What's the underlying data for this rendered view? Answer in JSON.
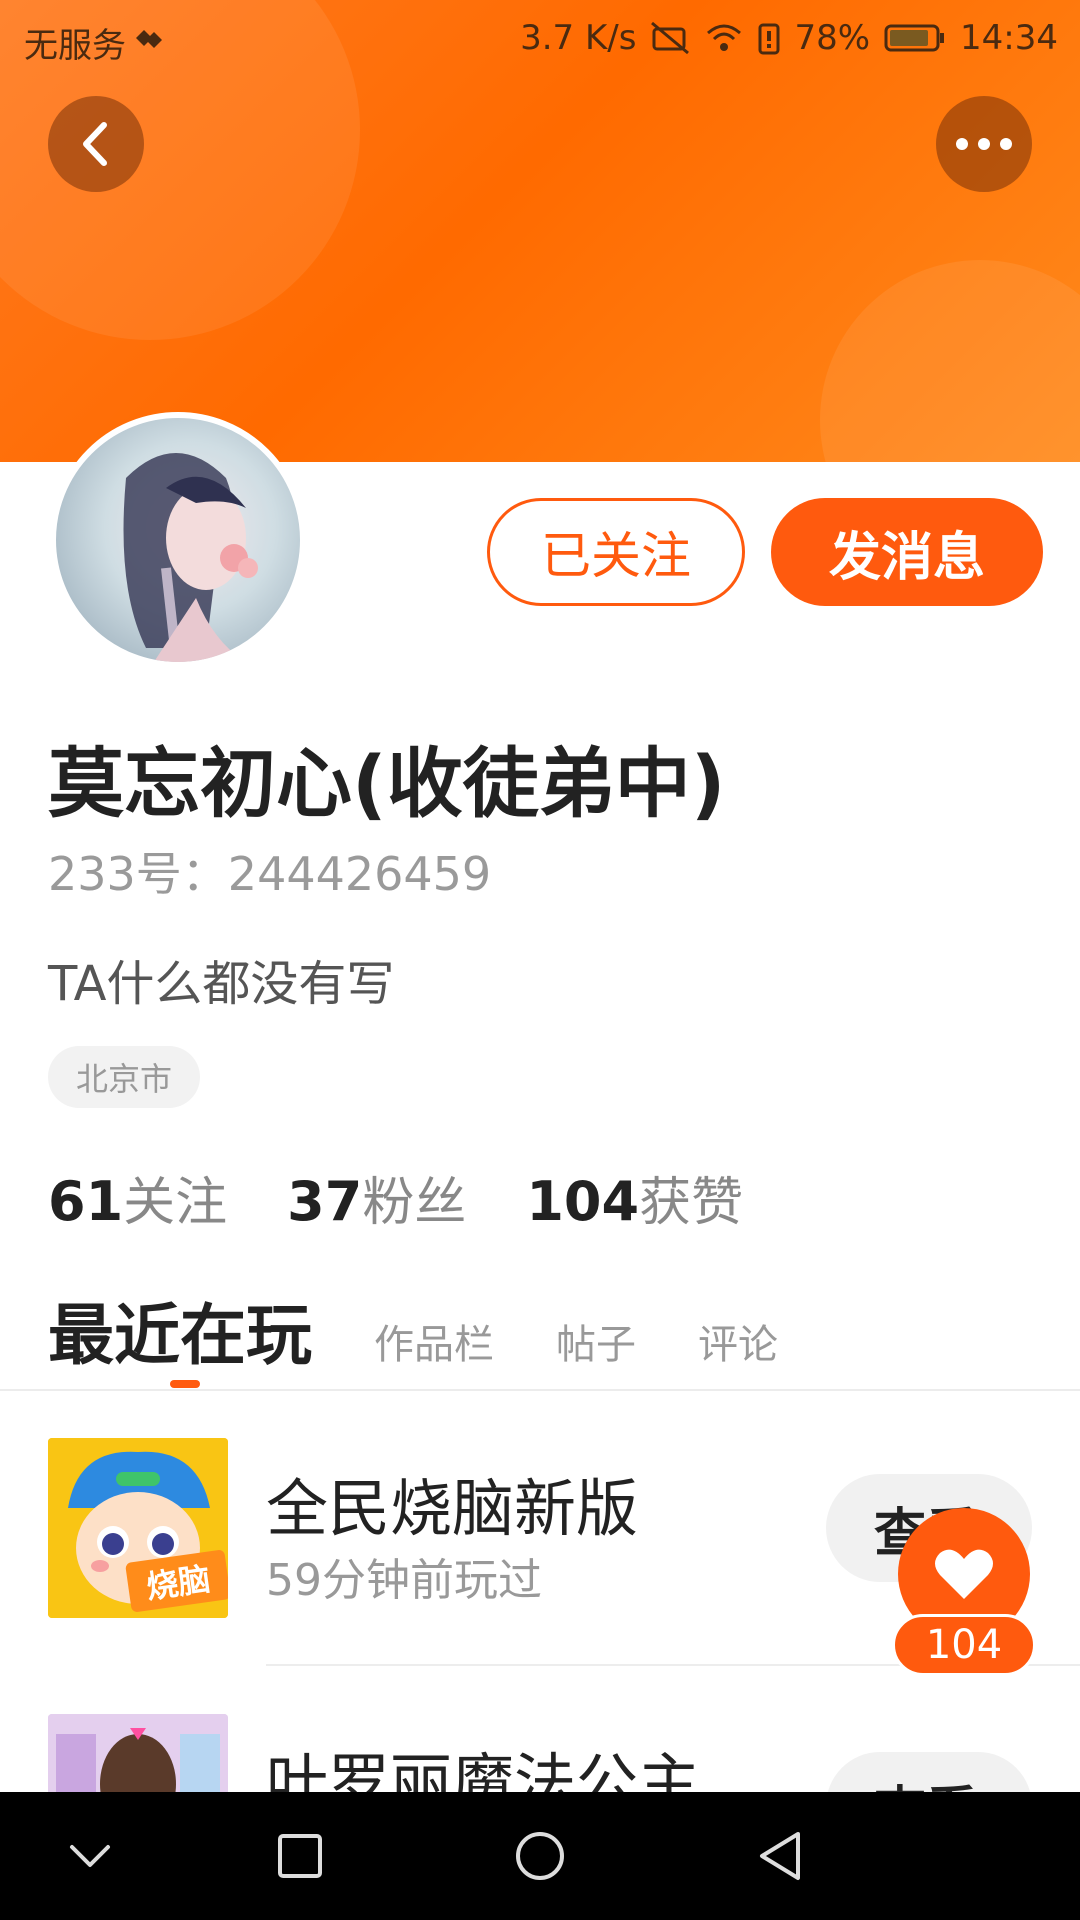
{
  "status_bar": {
    "carrier": "无服务",
    "net_speed": "3.7 K/s",
    "battery": "78%",
    "time": "14:34"
  },
  "header": {
    "back_icon": "chevron-left-icon",
    "more_icon": "more-dots-icon"
  },
  "profile": {
    "name": "莫忘初心(收徒弟中)",
    "uid": "233号：244426459",
    "bio": "TA什么都没有写",
    "location": "北京市",
    "follow_label": "已关注",
    "message_label": "发消息"
  },
  "stats": [
    {
      "value": "61",
      "label": "关注"
    },
    {
      "value": "37",
      "label": "粉丝"
    },
    {
      "value": "104",
      "label": "获赞"
    }
  ],
  "tabs": [
    {
      "label": "最近在玩",
      "active": true
    },
    {
      "label": "作品栏",
      "active": false
    },
    {
      "label": "帖子",
      "active": false
    },
    {
      "label": "评论",
      "active": false
    }
  ],
  "games": [
    {
      "title": "全民烧脑新版",
      "time": "59分钟前玩过",
      "icon_text": "烧脑",
      "view_label": "查看"
    },
    {
      "title": "叶罗丽魔法公主",
      "time": "",
      "icon_text": "",
      "view_label": "查看"
    }
  ],
  "like_float": {
    "count": "104"
  },
  "colors": {
    "accent": "#ff5a0e",
    "header": "#ff7a1f"
  }
}
